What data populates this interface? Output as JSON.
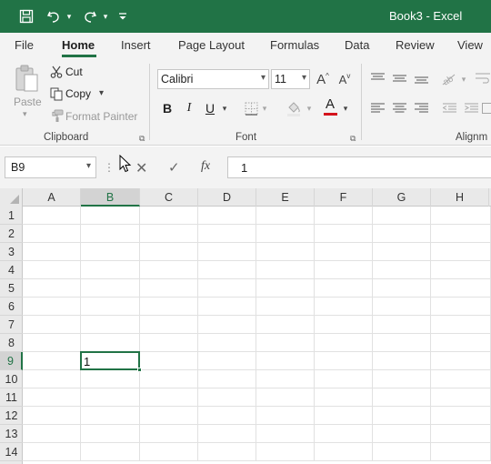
{
  "titlebar": {
    "title": "Book3 - Excel",
    "colors": {
      "accent": "#217346"
    },
    "icons": [
      "save-icon",
      "undo-icon",
      "redo-icon",
      "customize-toolbar-icon"
    ]
  },
  "ribbon_tabs": [
    "File",
    "Home",
    "Insert",
    "Page Layout",
    "Formulas",
    "Data",
    "Review",
    "View"
  ],
  "ribbon": {
    "clipboard": {
      "paste": "Paste",
      "cut": "Cut",
      "copy": "Copy",
      "format_painter": "Format Painter",
      "group_label": "Clipboard"
    },
    "font": {
      "font_name": "Calibri",
      "font_size": "11",
      "group_label": "Font",
      "bold": "B",
      "italic": "I",
      "underline": "U",
      "grow": "A",
      "shrink": "A",
      "font_color": "A"
    },
    "alignment": {
      "group_label": "Alignm"
    }
  },
  "formula_bar": {
    "name_box": "B9",
    "fx": "fx",
    "value": "1"
  },
  "grid": {
    "columns": [
      "A",
      "B",
      "C",
      "D",
      "E",
      "F",
      "G",
      "H"
    ],
    "rows": [
      "1",
      "2",
      "3",
      "4",
      "5",
      "6",
      "7",
      "8",
      "9",
      "10",
      "11",
      "12",
      "13",
      "14"
    ],
    "selected_cell": "B9",
    "cell_values": {
      "B9": "1"
    }
  }
}
